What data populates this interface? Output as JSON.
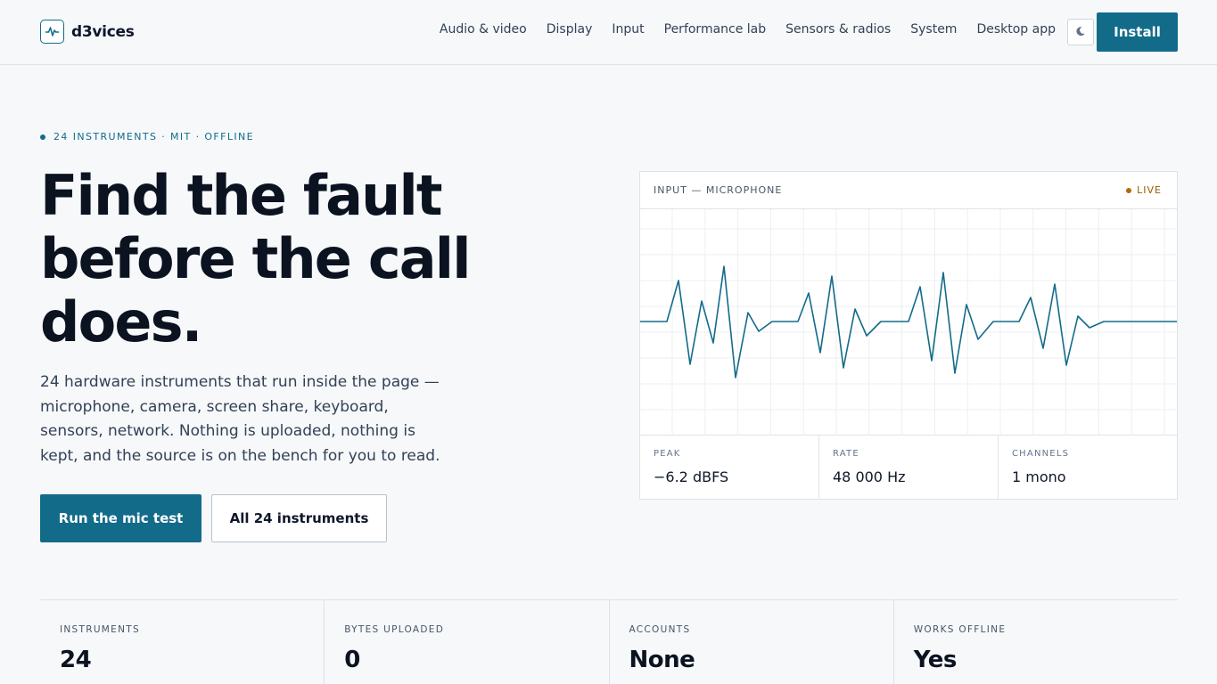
{
  "brand": {
    "name": "d3vices",
    "icon": "pulse-icon"
  },
  "nav": [
    {
      "label": "Audio & video"
    },
    {
      "label": "Display"
    },
    {
      "label": "Input"
    },
    {
      "label": "Performance lab"
    },
    {
      "label": "Sensors & radios"
    },
    {
      "label": "System"
    },
    {
      "label": "Desktop app"
    }
  ],
  "header": {
    "theme_icon": "theme-toggle-icon",
    "install_label": "Install"
  },
  "hero": {
    "eyebrow": "24 INSTRUMENTS · MIT · OFFLINE",
    "title": "Find the fault before the call does.",
    "description": "24 hardware instruments that run inside the page — microphone, camera, screen share, keyboard, sensors, network. Nothing is uploaded, nothing is kept, and the source is on the bench for you to read.",
    "primary_label": "Run the mic test",
    "secondary_label": "All 24 instruments"
  },
  "panel": {
    "label": "INPUT — MICROPHONE",
    "status": "LIVE",
    "stats": [
      {
        "label": "PEAK",
        "value": "−6.2 dBFS"
      },
      {
        "label": "RATE",
        "value": "48 000 Hz"
      },
      {
        "label": "CHANNELS",
        "value": "1 mono"
      }
    ]
  },
  "facts": [
    {
      "label": "INSTRUMENTS",
      "value": "24"
    },
    {
      "label": "BYTES UPLOADED",
      "value": "0"
    },
    {
      "label": "ACCOUNTS",
      "value": "None"
    },
    {
      "label": "WORKS OFFLINE",
      "value": "Yes"
    }
  ],
  "colors": {
    "accent": "#136b8a",
    "live": "#b26a00",
    "background": "#f6f8fa",
    "border": "#dde3e9"
  }
}
